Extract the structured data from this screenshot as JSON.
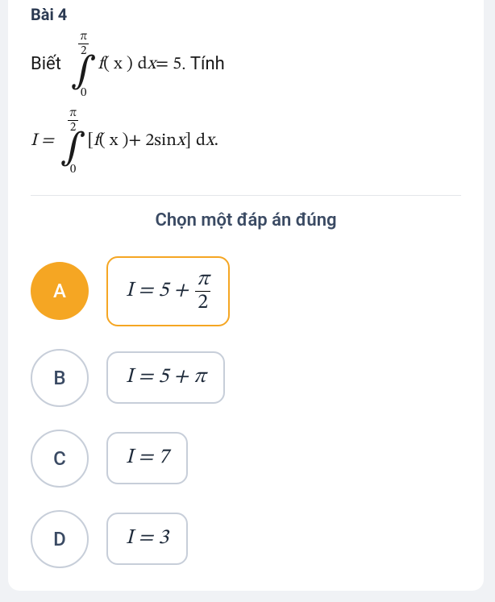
{
  "title": "Bài 4",
  "question": {
    "word_biet": "Biết",
    "int1_upper_num": "π",
    "int1_upper_den": "2",
    "int1_lower": "0",
    "int1_body_a": "f",
    "int1_body_b": "( x )",
    "int1_body_c": "d",
    "int1_body_d": "x",
    "int1_eq": "= 5",
    "word_tinh": ". Tính",
    "line2_lhs": "I =",
    "int2_upper_num": "π",
    "int2_upper_den": "2",
    "int2_lower": "0",
    "int2_body_open": "[",
    "int2_body_f": "f",
    "int2_body_args": "( x )",
    "int2_body_plus": " + 2sin",
    "int2_body_x": "x",
    "int2_body_close": "]",
    "int2_body_d": "d",
    "int2_body_x2": "x",
    "int2_body_dot": "."
  },
  "prompt": "Chọn một đáp án đúng",
  "options": {
    "A": {
      "letter": "A",
      "prefix": "I = 5 +",
      "frac_num": "π",
      "frac_den": "2",
      "selected": true
    },
    "B": {
      "letter": "B",
      "text": "I = 5 + π",
      "selected": false
    },
    "C": {
      "letter": "C",
      "text": "I = 7",
      "selected": false
    },
    "D": {
      "letter": "D",
      "text": "I = 3",
      "selected": false
    }
  }
}
